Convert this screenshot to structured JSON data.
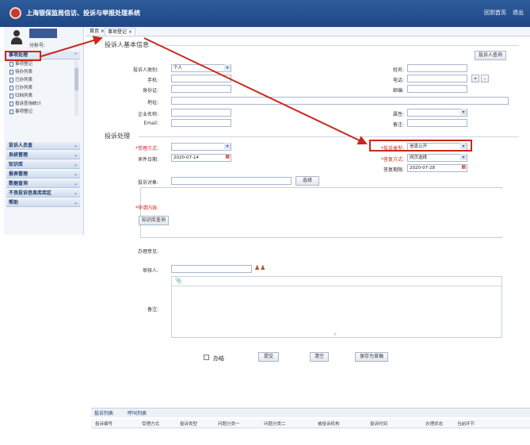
{
  "app": {
    "title": "上海银保监局信访、投诉与举报处理系统",
    "tools": [
      "回到首页",
      "退出"
    ]
  },
  "user": {
    "account_label": "分析号:"
  },
  "sidebar": {
    "sections": [
      {
        "label": "事项处理",
        "expanded": true
      },
      {
        "label": "投诉人员查",
        "expanded": false
      },
      {
        "label": "系统管理",
        "expanded": false
      },
      {
        "label": "知识库",
        "expanded": false
      },
      {
        "label": "报表管理",
        "expanded": false
      },
      {
        "label": "数据查询",
        "expanded": false
      },
      {
        "label": "不良投诉信息库库区",
        "expanded": false
      },
      {
        "label": "帮助",
        "expanded": false
      }
    ],
    "items": [
      "事项登记",
      "待办列表",
      "已办列表",
      "已办列表",
      "归档列表",
      "投诉查询统计",
      "事项登记"
    ]
  },
  "tabs": [
    {
      "label": "首页"
    },
    {
      "label": "事项登记"
    }
  ],
  "form": {
    "section1_title": "投诉人基本信息",
    "complainant_query_button": "投诉人查询",
    "fields": {
      "person_type_label": "投诉人类别:",
      "person_type_value": "个人",
      "phone_label": "手机:",
      "id_label": "身份证:",
      "address_label": "地址:",
      "company_label": "企业名称:",
      "email_label": "Email:",
      "name_label": "姓名:",
      "tel_label": "电话:",
      "postcode_label": "邮编:",
      "region_label": "属性:",
      "note_label": "备注:"
    },
    "section2_title": "投诉处理",
    "handle": {
      "accept_method_label": "*受理方式:",
      "case_date_label": "来件日期:",
      "case_date_value": "2020-07-14",
      "complaint_type_label": "*投诉类型:",
      "complaint_type_value": "信息公开",
      "reply_method_label": "*答复方式:",
      "reply_method_value": "网页选择",
      "reply_deadline_label": "答复期限:",
      "reply_deadline_value": "2020-07-28",
      "object_label": "投诉对象:",
      "object_button": "选择",
      "content_label": "*申请内容:",
      "knowledge_button": "知识库查询",
      "opinion_label": "办理意见:",
      "reviewer_label": "审核人:",
      "remark_label": "备注:"
    },
    "actions": {
      "checkbox_label": "办结",
      "submit": "提交",
      "clear": "清空",
      "save_template": "保存为草稿"
    }
  },
  "bottom": {
    "tabs": [
      "投诉列表",
      "呼叫列表"
    ],
    "columns": [
      "投诉编号",
      "受理方式",
      "投诉类型",
      "问题分类一",
      "问题分类二",
      "被投诉机构",
      "投诉时间",
      "办理状态",
      "当前环节"
    ]
  },
  "colors": {
    "header": "#1e4783",
    "highlight": "#c8281e",
    "accent": "#3a5a92"
  }
}
